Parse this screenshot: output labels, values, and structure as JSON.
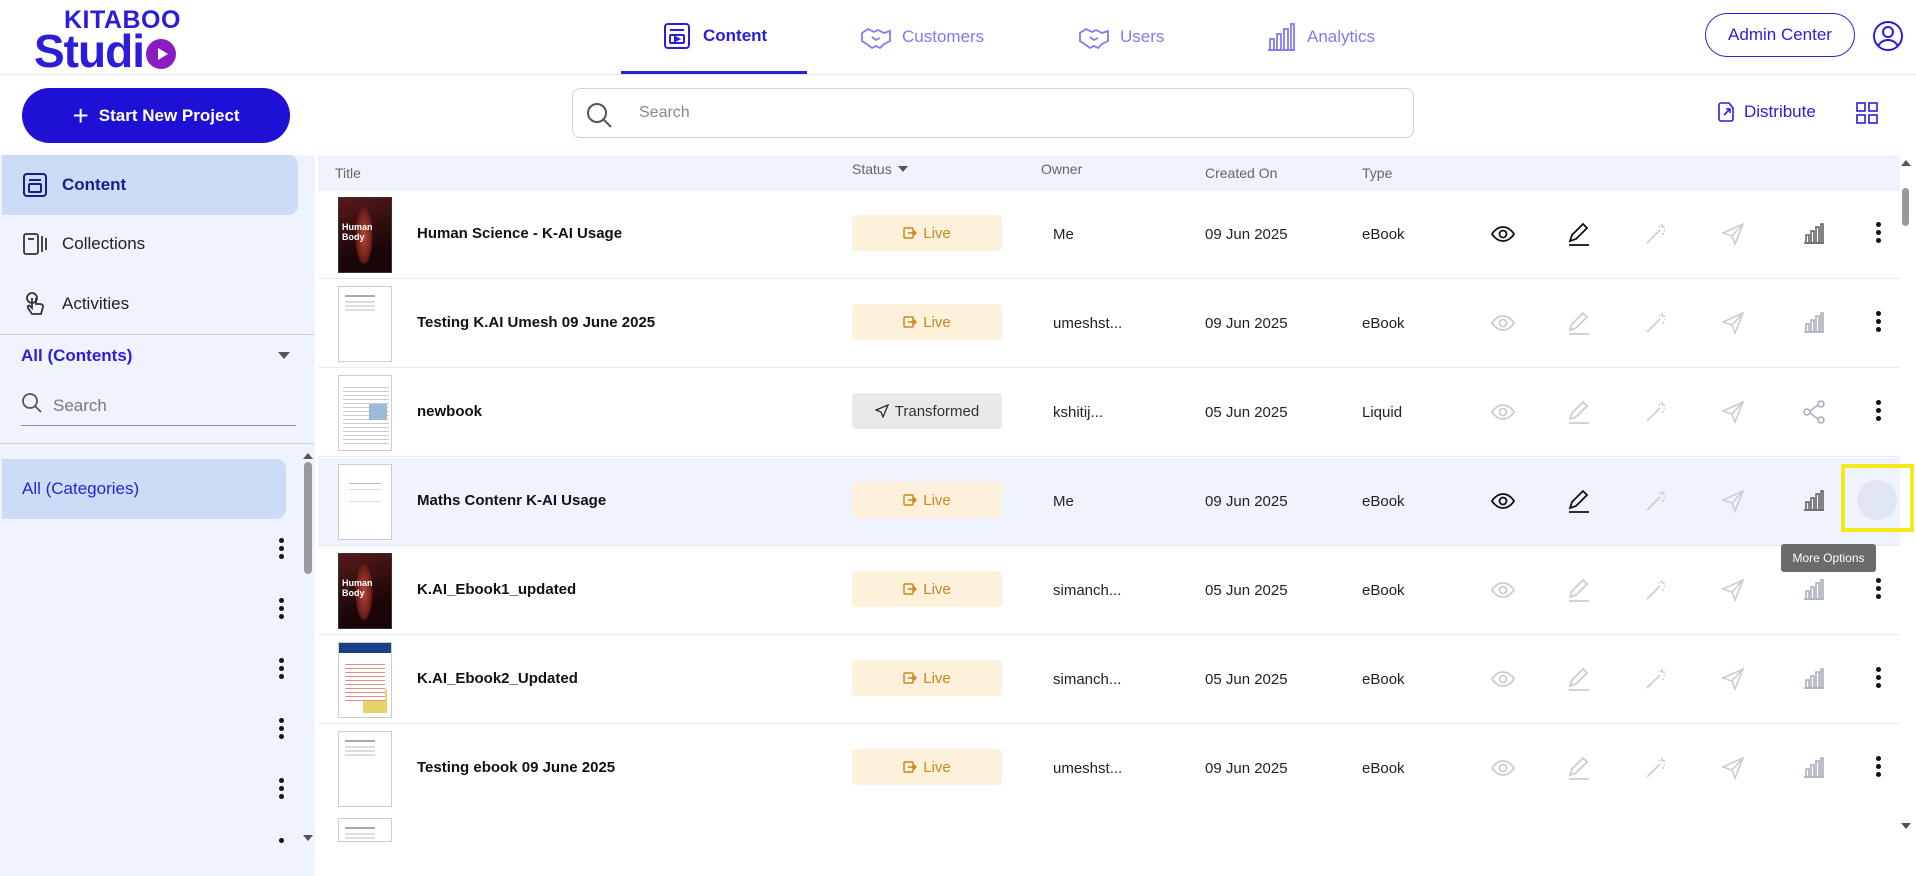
{
  "brand": {
    "line1": "KITABOO",
    "line2": "Studi"
  },
  "nav": {
    "content": "Content",
    "customers": "Customers",
    "users": "Users",
    "analytics": "Analytics"
  },
  "header": {
    "admin_center": "Admin Center"
  },
  "toolbar": {
    "start_new_project": "Start New Project",
    "search_placeholder": "Search",
    "distribute": "Distribute"
  },
  "sidebar": {
    "items": [
      {
        "label": "Content"
      },
      {
        "label": "Collections"
      },
      {
        "label": "Activities"
      }
    ],
    "filter": "All (Contents)",
    "search_placeholder": "Search",
    "category": "All (Categories)"
  },
  "table": {
    "columns": {
      "title": "Title",
      "status": "Status",
      "owner": "Owner",
      "created_on": "Created On",
      "type": "Type"
    },
    "rows": [
      {
        "title": "Human Science - K-AI Usage",
        "status": "Live",
        "owner": "Me",
        "created": "09 Jun 2025",
        "type": "eBook"
      },
      {
        "title": "Testing K.AI Umesh 09 June 2025",
        "status": "Live",
        "owner": "umeshst...",
        "created": "09 Jun 2025",
        "type": "eBook"
      },
      {
        "title": "newbook",
        "status": "Transformed",
        "owner": "kshitij...",
        "created": "05 Jun 2025",
        "type": "Liquid"
      },
      {
        "title": "Maths Contenr K-AI Usage",
        "status": "Live",
        "owner": "Me",
        "created": "09 Jun 2025",
        "type": "eBook"
      },
      {
        "title": "K.AI_Ebook1_updated",
        "status": "Live",
        "owner": "simanch...",
        "created": "05 Jun 2025",
        "type": "eBook"
      },
      {
        "title": "K.AI_Ebook2_Updated",
        "status": "Live",
        "owner": "simanch...",
        "created": "05 Jun 2025",
        "type": "eBook"
      },
      {
        "title": "Testing ebook 09 June 2025",
        "status": "Live",
        "owner": "umeshst...",
        "created": "09 Jun 2025",
        "type": "eBook"
      }
    ]
  },
  "tooltip": {
    "more_options": "More Options"
  },
  "colors": {
    "brand": "#2b1ed9",
    "accent_purple": "#8a1dc2",
    "live_bg": "#fdf1dc",
    "live_text": "#c7881d",
    "highlight": "#f4ea1a"
  }
}
